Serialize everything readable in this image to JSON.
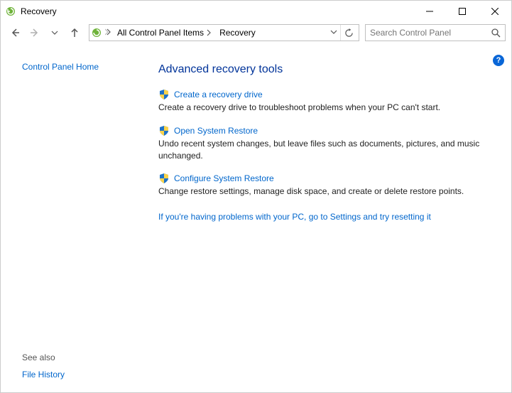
{
  "window": {
    "title": "Recovery"
  },
  "breadcrumb": {
    "segment1": "All Control Panel Items",
    "segment2": "Recovery"
  },
  "search": {
    "placeholder": "Search Control Panel"
  },
  "sidebar": {
    "home": "Control Panel Home",
    "seealso_title": "See also",
    "seealso_link": "File History"
  },
  "main": {
    "heading": "Advanced recovery tools",
    "tools": [
      {
        "link": "Create a recovery drive",
        "desc": "Create a recovery drive to troubleshoot problems when your PC can't start."
      },
      {
        "link": "Open System Restore",
        "desc": "Undo recent system changes, but leave files such as documents, pictures, and music unchanged."
      },
      {
        "link": "Configure System Restore",
        "desc": "Change restore settings, manage disk space, and create or delete restore points."
      }
    ],
    "extra_link": "If you're having problems with your PC, go to Settings and try resetting it"
  },
  "help": {
    "label": "?"
  }
}
